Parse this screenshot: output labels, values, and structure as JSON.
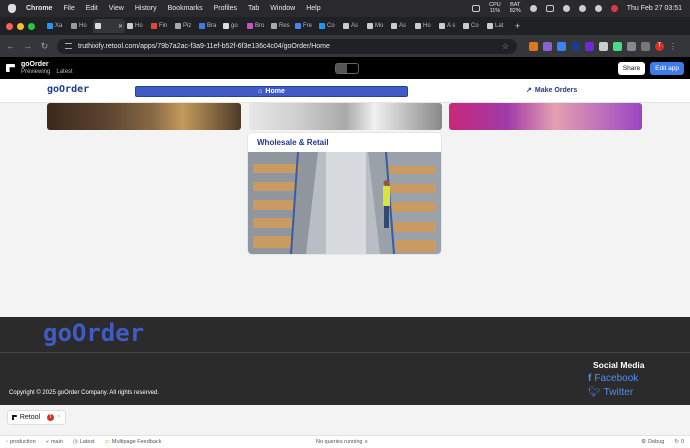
{
  "menubar": {
    "app": "Chrome",
    "items": [
      "File",
      "Edit",
      "View",
      "History",
      "Bookmarks",
      "Profiles",
      "Tab",
      "Window",
      "Help"
    ],
    "stats": [
      [
        "CPU",
        "11%"
      ],
      [
        "BAT",
        "82%"
      ]
    ],
    "datetime": "Thu Feb 27  03:51"
  },
  "tabs": [
    "Xa",
    "Ho",
    "",
    "Ho",
    "Fin",
    "Piz",
    "Bra",
    "go",
    "Bro",
    "Res",
    "Fre",
    "Co",
    "As",
    "Mo",
    "As",
    "Ho",
    "A s",
    "Co",
    "Lat"
  ],
  "browser": {
    "url": "truthixify.retool.com/apps/79b7a2ac-f3a9-11ef-b52f-6f3e136c4c04/goOrder/Home",
    "profile_initial": "T"
  },
  "retool_header": {
    "app_name": "goOrder",
    "mode": "Previewing",
    "version": "Latest",
    "share_label": "Share",
    "edit_label": "Edit app"
  },
  "app": {
    "logo": "goOrder",
    "nav": {
      "home_label": "Home",
      "orders_label": "Make Orders"
    },
    "cards": [
      {
        "title": "Wholesale & Retail"
      }
    ]
  },
  "footer": {
    "logo": "goOrder",
    "copyright": "Copyright © 2025 goOrder Company. All rights reserved.",
    "social_title": "Social Media",
    "facebook": "Facebook",
    "twitter": "Twitter"
  },
  "retool_badge": {
    "label": "Retool",
    "user_initial": "T"
  },
  "statusbar": {
    "env": "production",
    "branch": "main",
    "version": "Latest",
    "feedback": "Multipage Feedback",
    "queries": "No queries running",
    "debug": "Debug",
    "right_value": "0"
  },
  "colors": {
    "brand": "#3f5bc6",
    "brand_dark": "#1f3a8f",
    "social": "#4f8ef0",
    "footer_bg": "#2b2b2b"
  }
}
